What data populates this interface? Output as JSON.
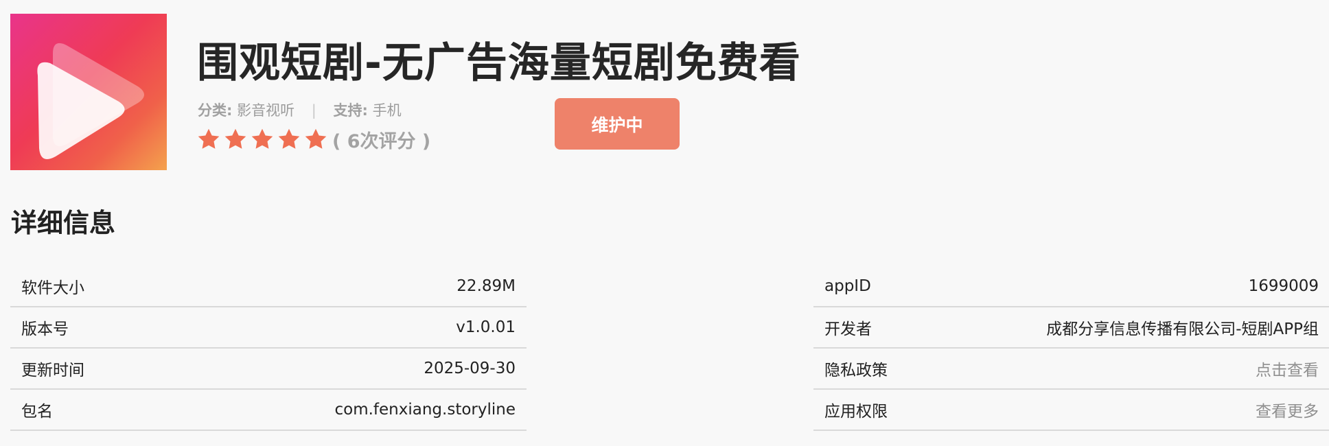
{
  "app": {
    "title": "围观短剧-无广告海量短剧免费看",
    "icon_name": "play-triangle-icon"
  },
  "meta": {
    "category_label": "分类:",
    "category_value": "影音视听",
    "separator": "|",
    "support_label": "支持:",
    "support_value": "手机"
  },
  "rating": {
    "stars": 5,
    "count_text": "( 6次评分 )",
    "star_color": "#ef6f52"
  },
  "status_button": {
    "label": "维护中",
    "color": "#ee826a"
  },
  "details": {
    "section_title": "详细信息",
    "left": [
      {
        "label": "软件大小",
        "value": "22.89M"
      },
      {
        "label": "版本号",
        "value": "v1.0.01"
      },
      {
        "label": "更新时间",
        "value": "2025-09-30"
      },
      {
        "label": "包名",
        "value": "com.fenxiang.storyline"
      }
    ],
    "right": [
      {
        "label": "appID",
        "value": "1699009"
      },
      {
        "label": "开发者",
        "value": "成都分享信息传播有限公司-短剧APP组"
      },
      {
        "label": "隐私政策",
        "value": "点击查看"
      },
      {
        "label": "应用权限",
        "value": "查看更多"
      }
    ]
  }
}
